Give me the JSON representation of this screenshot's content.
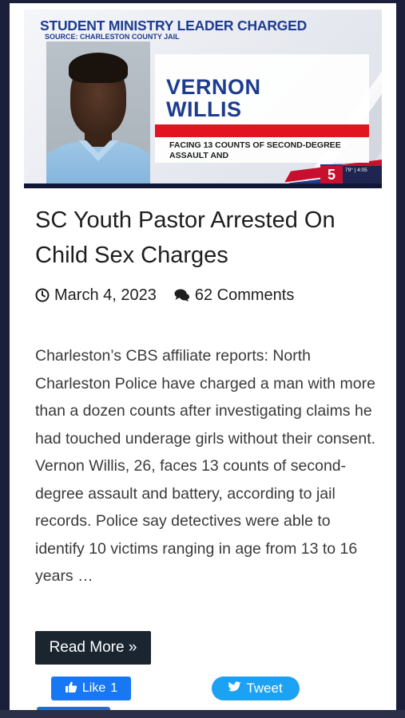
{
  "news_image": {
    "headline": "STUDENT MINISTRY LEADER CHARGED",
    "source": "SOURCE: CHARLESTON COUNTY JAIL",
    "name_first": "VERNON",
    "name_last": "WILLIS",
    "charge": "FACING 13 COUNTS OF SECOND-DEGREE ASSAULT AND",
    "channel_logo": "5",
    "weather": "79° | 4:05"
  },
  "article": {
    "title": "SC Youth Pastor Arrested On Child Sex Charges",
    "date": "March 4, 2023",
    "comments": "62 Comments",
    "excerpt": "Charleston’s CBS affiliate reports: North Charleston Police have charged a man with more than a dozen counts after investigating claims he had touched underage girls without their consent. Vernon Willis, 26, faces 13 counts of second-degree assault and battery, according to jail records. Police say detectives were able to identify 10 victims ranging in age from 13 to 16 years …",
    "read_more_label": "Read More »"
  },
  "social": {
    "like_label": "Like",
    "like_count": "1",
    "tweet_label": "Tweet"
  },
  "colors": {
    "page_background": "#1b1f3a",
    "read_more": "#1a2530",
    "facebook": "#1877f2",
    "twitter": "#1da1f2",
    "news_blue": "#1d3c8f",
    "news_red": "#e1141f"
  },
  "icons": [
    "clock-icon",
    "comment-icon",
    "thumbs-up-icon",
    "twitter-bird-icon"
  ]
}
